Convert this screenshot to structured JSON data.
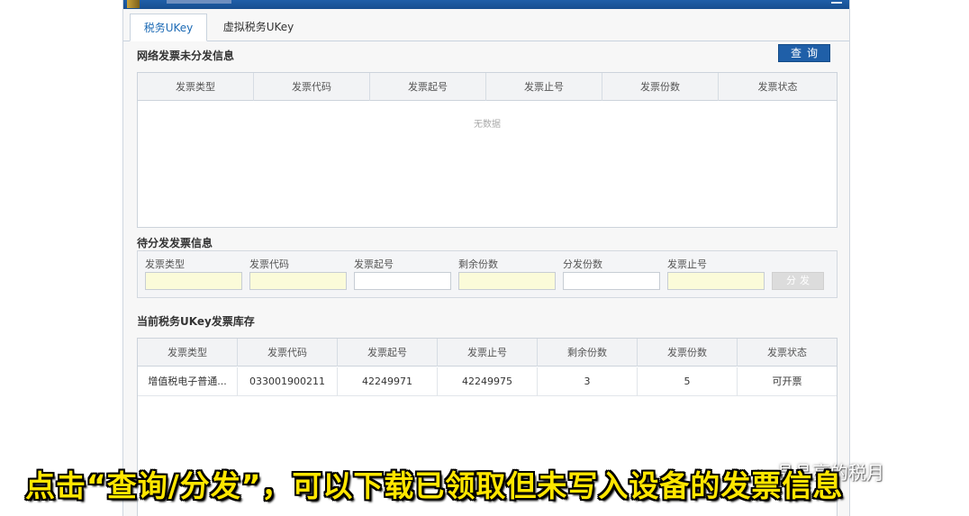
{
  "tabs": [
    {
      "label": "税务UKey",
      "active": true
    },
    {
      "label": "虚拟税务UKey",
      "active": false
    }
  ],
  "network": {
    "title": "网络发票未分发信息",
    "query_label": "查询",
    "columns": [
      "发票类型",
      "发票代码",
      "发票起号",
      "发票止号",
      "发票份数",
      "发票状态"
    ],
    "empty_text": "无数据"
  },
  "pending": {
    "title": "待分发发票信息",
    "fields": [
      {
        "label": "发票类型",
        "value": "",
        "readonly": true
      },
      {
        "label": "发票代码",
        "value": "",
        "readonly": true
      },
      {
        "label": "发票起号",
        "value": "",
        "readonly": false
      },
      {
        "label": "剩余份数",
        "value": "",
        "readonly": true
      },
      {
        "label": "分发份数",
        "value": "",
        "readonly": false
      },
      {
        "label": "发票止号",
        "value": "",
        "readonly": true
      }
    ],
    "distribute_label": "分发"
  },
  "inventory": {
    "title": "当前税务UKey发票库存",
    "columns": [
      "发票类型",
      "发票代码",
      "发票起号",
      "发票止号",
      "剩余份数",
      "发票份数",
      "发票状态"
    ],
    "rows": [
      [
        "增值税电子普通...",
        "033001900211",
        "42249971",
        "42249975",
        "3",
        "5",
        "可开票"
      ]
    ]
  },
  "caption": "点击“查询/分发”，可以下载已领取但未写入设备的发票信息",
  "watermark": "晶晶亮的税月",
  "colors": {
    "titlebar": "#1f5fa8",
    "accent_text": "#1c6ab5",
    "query_button": "#1f5fa8",
    "readonly_field": "#fbfbd9",
    "caption_text": "#ffe600"
  }
}
